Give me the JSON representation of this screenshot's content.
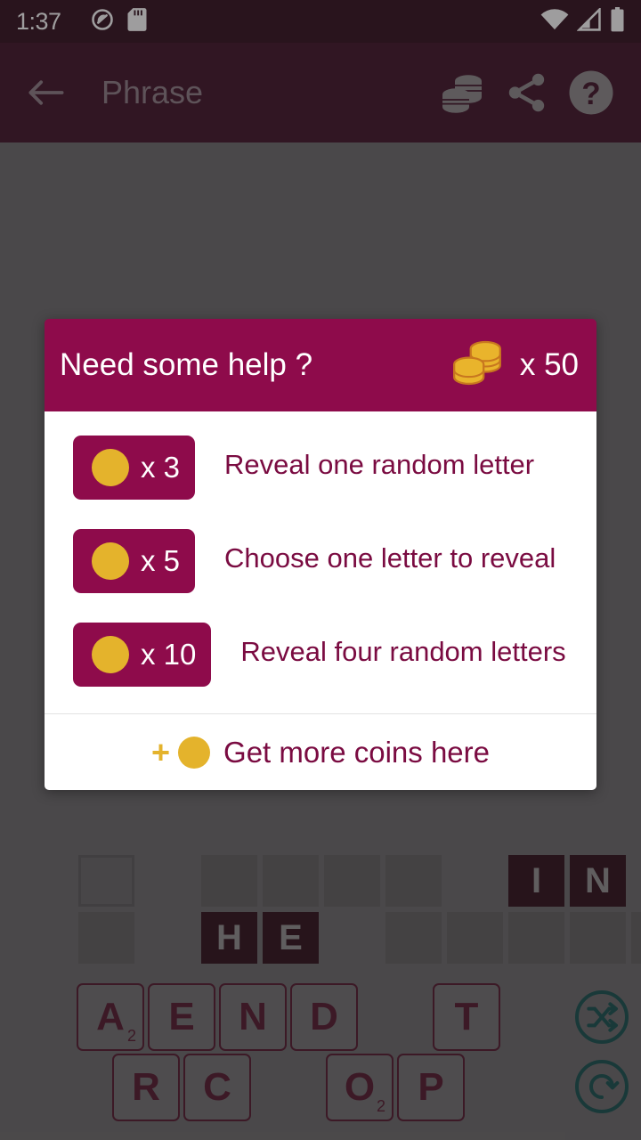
{
  "status_bar": {
    "clock": "1:37",
    "left_icons": [
      "dnd-off-icon",
      "sd-card-icon"
    ],
    "right_icons": [
      "wifi-icon",
      "cellular-signal-icon",
      "battery-icon"
    ]
  },
  "app_bar": {
    "back_icon": "back-arrow-icon",
    "title": "Phrase",
    "actions": [
      {
        "icon": "coins-icon"
      },
      {
        "icon": "share-icon"
      },
      {
        "icon": "help-icon"
      }
    ]
  },
  "dialog": {
    "title": "Need some help ?",
    "coin_icon": "coin-stack-icon",
    "coin_count": "x 50",
    "options": [
      {
        "coin_icon": "coin-icon",
        "cost": "x 3",
        "description": "Reveal one random letter"
      },
      {
        "coin_icon": "coin-icon",
        "cost": "x 5",
        "description": "Choose one letter to reveal"
      },
      {
        "coin_icon": "coin-icon",
        "cost": "x 10",
        "description": "Reveal four random letters"
      }
    ],
    "footer": {
      "plus": "+",
      "coin_icon": "coin-icon",
      "label": "Get more coins here"
    }
  },
  "game_board": {
    "row1": [
      {
        "state": "outline",
        "letter": ""
      },
      {
        "state": "blank",
        "letter": ""
      },
      {
        "state": "empty",
        "letter": ""
      },
      {
        "state": "empty",
        "letter": ""
      },
      {
        "state": "empty",
        "letter": ""
      },
      {
        "state": "empty",
        "letter": ""
      },
      {
        "state": "blank",
        "letter": ""
      },
      {
        "state": "filled",
        "letter": "I"
      },
      {
        "state": "filled",
        "letter": "N"
      }
    ],
    "row2": [
      {
        "state": "empty",
        "letter": ""
      },
      {
        "state": "blank",
        "letter": ""
      },
      {
        "state": "filled",
        "letter": "H"
      },
      {
        "state": "filled",
        "letter": "E"
      },
      {
        "state": "blank",
        "letter": ""
      },
      {
        "state": "empty",
        "letter": ""
      },
      {
        "state": "empty",
        "letter": ""
      },
      {
        "state": "empty",
        "letter": ""
      },
      {
        "state": "empty",
        "letter": ""
      },
      {
        "state": "empty",
        "letter": ""
      }
    ]
  },
  "letter_tiles": {
    "row1": [
      {
        "letter": "A",
        "points": "2",
        "visible": true
      },
      {
        "letter": "E",
        "points": "",
        "visible": true
      },
      {
        "letter": "N",
        "points": "",
        "visible": true
      },
      {
        "letter": "D",
        "points": "",
        "visible": true
      },
      {
        "letter": "",
        "points": "",
        "visible": false
      },
      {
        "letter": "T",
        "points": "",
        "visible": true
      }
    ],
    "row2": [
      {
        "letter": "R",
        "points": "",
        "visible": true
      },
      {
        "letter": "C",
        "points": "",
        "visible": true
      },
      {
        "letter": "",
        "points": "",
        "visible": false
      },
      {
        "letter": "O",
        "points": "2",
        "visible": true
      },
      {
        "letter": "P",
        "points": "",
        "visible": true
      }
    ]
  },
  "board_actions": [
    {
      "icon": "shuffle-icon"
    },
    {
      "icon": "undo-icon"
    }
  ],
  "colors": {
    "status_bar_bg": "#2b0614",
    "app_bar_bg": "#3a0a20",
    "dialog_header_bg": "#8e0b4b",
    "dialog_body_bg": "#ffffff",
    "accent_magenta": "#7a0b41",
    "coin_gold": "#e4b32c",
    "scrim": "#676566",
    "tile_teal": "#0e4a47"
  }
}
